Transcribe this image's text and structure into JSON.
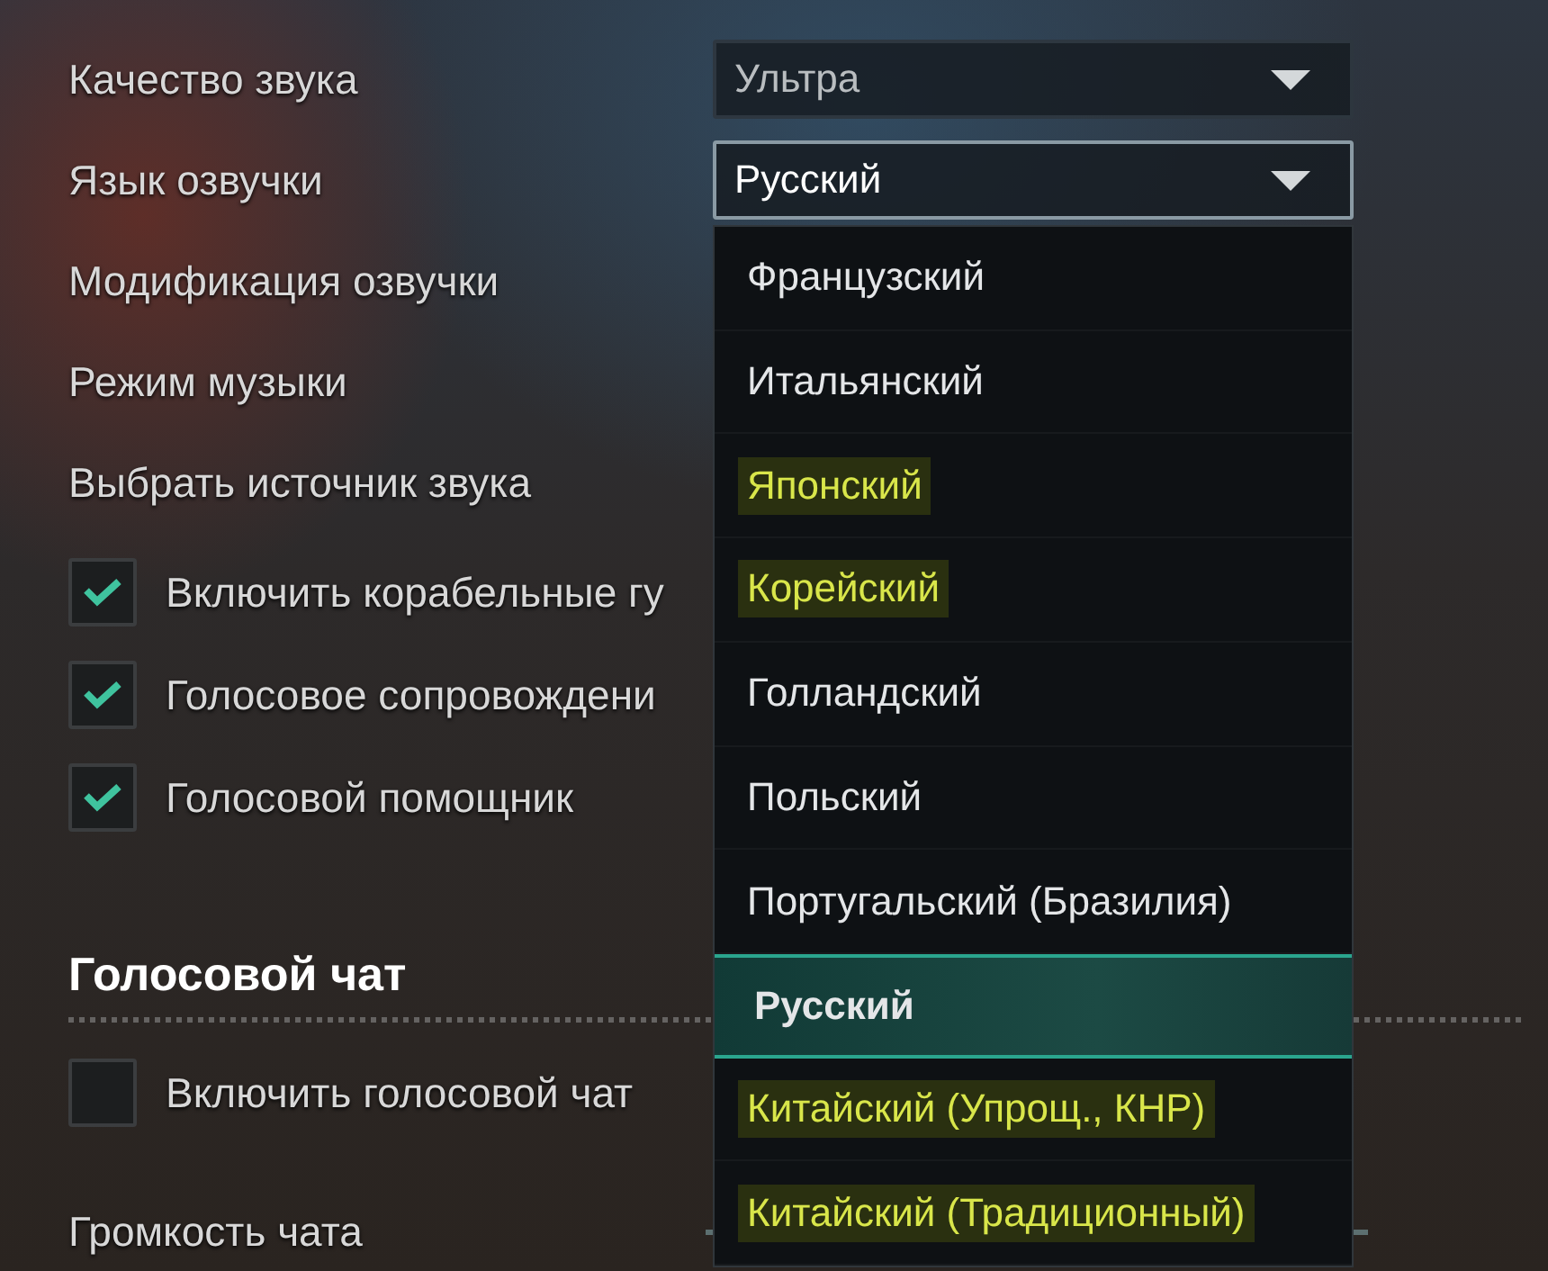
{
  "settings": [
    {
      "label": "Качество звука",
      "value": "Ультра",
      "focused": false
    },
    {
      "label": "Язык озвучки",
      "value": "Русский",
      "focused": true
    },
    {
      "label": "Модификация озвучки"
    },
    {
      "label": "Режим музыки"
    },
    {
      "label": "Выбрать источник звука"
    }
  ],
  "checkboxes": [
    {
      "label": "Включить корабельные гу",
      "checked": true
    },
    {
      "label": "Голосовое сопровождени",
      "checked": true
    },
    {
      "label": "Голосовой помощник",
      "checked": true
    }
  ],
  "voice_chat": {
    "title": "Голосовой чат",
    "checkboxes": [
      {
        "label": "Включить голосовой чат",
        "checked": false
      }
    ],
    "volume_label": "Громкость чата"
  },
  "language_list": [
    {
      "label": "Французский",
      "highlighted": false,
      "selected": false
    },
    {
      "label": "Итальянский",
      "highlighted": false,
      "selected": false
    },
    {
      "label": "Японский",
      "highlighted": true,
      "selected": false
    },
    {
      "label": "Корейский",
      "highlighted": true,
      "selected": false
    },
    {
      "label": "Голландский",
      "highlighted": false,
      "selected": false
    },
    {
      "label": "Польский",
      "highlighted": false,
      "selected": false
    },
    {
      "label": "Португальский (Бразилия)",
      "highlighted": false,
      "selected": false
    },
    {
      "label": "Русский",
      "highlighted": false,
      "selected": true
    },
    {
      "label": "Китайский (Упрощ., КНР)",
      "highlighted": true,
      "selected": false
    },
    {
      "label": "Китайский (Традиционный)",
      "highlighted": true,
      "selected": false
    }
  ]
}
